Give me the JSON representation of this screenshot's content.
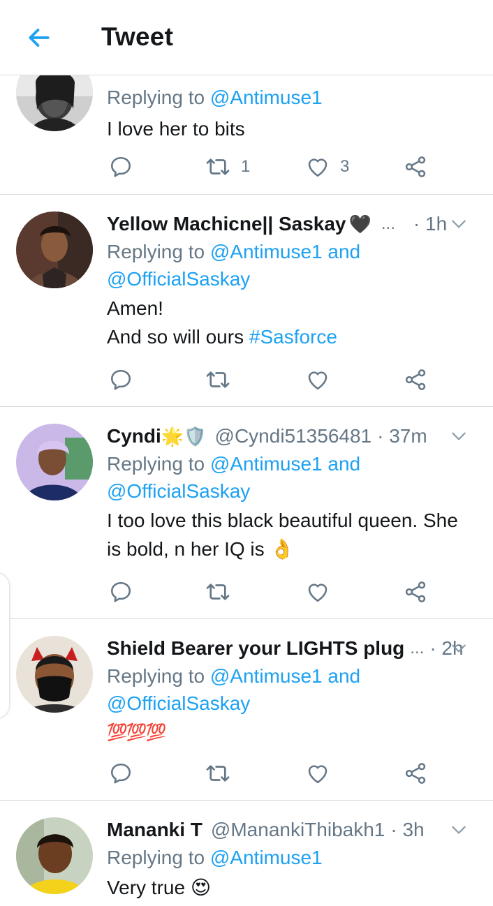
{
  "header": {
    "title": "Tweet"
  },
  "tweets": [
    {
      "replying_prefix": "Replying to",
      "replying_to": "@Antimuse1",
      "text": "I love her to bits",
      "retweet_count": "1",
      "like_count": "3"
    },
    {
      "name": "Yellow Machicne|| Saskay",
      "emoji": "🖤",
      "ellipsis": "...",
      "time": "· 1h",
      "replying_prefix": "Replying to",
      "replying_to": "@Antimuse1 and",
      "replying_to_2": "@OfficialSaskay",
      "text_1": "Amen!",
      "text_2": "And so will ours",
      "hashtag": "#Sasforce"
    },
    {
      "name": "Cyndi",
      "emoji": "🌟🛡️",
      "handle": "@Cyndi51356481",
      "time": "· 37m",
      "replying_prefix": "Replying to",
      "replying_to": "@Antimuse1 and",
      "replying_to_2": "@OfficialSaskay",
      "text_1": "I too love this black beautiful queen. She",
      "text_2": "is bold, n her IQ is",
      "text_emoji": "👌"
    },
    {
      "name": "Shield Bearer your LIGHTS plug",
      "ellipsis": "...",
      "time": "· 2h",
      "replying_prefix": "Replying to",
      "replying_to": "@Antimuse1 and",
      "replying_to_2": "@OfficialSaskay",
      "text": "💯💯💯"
    },
    {
      "name": "Mananki T",
      "handle": "@ManankiThibakh1",
      "time": "· 3h",
      "replying_prefix": "Replying to",
      "replying_to": "@Antimuse1",
      "text": "Very true",
      "text_emoji": "😍"
    }
  ],
  "icons": {
    "back": "back-arrow-icon",
    "reply": "reply-icon",
    "retweet": "retweet-icon",
    "like": "like-icon",
    "share": "share-icon",
    "chevron": "chevron-down-icon"
  },
  "colors": {
    "accent": "#1da1f2",
    "secondary_text": "#657786",
    "primary_text": "#14171a",
    "divider": "#d7dce0"
  }
}
